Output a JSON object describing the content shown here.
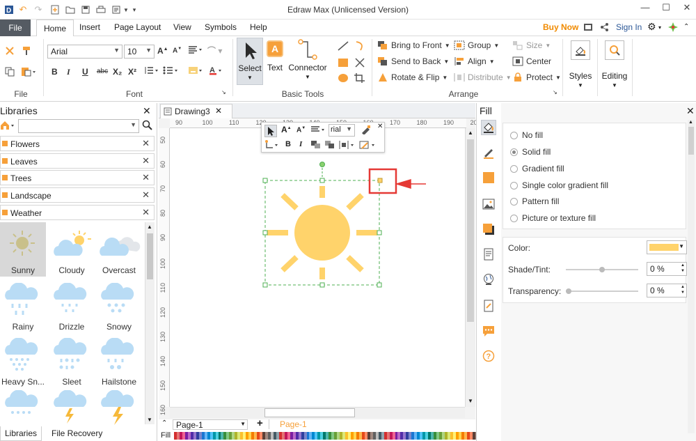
{
  "app": {
    "title": "Edraw Max (Unlicensed Version)",
    "buy_now": "Buy Now",
    "sign_in": "Sign In"
  },
  "menu": {
    "file": "File",
    "tabs": [
      "Home",
      "Insert",
      "Page Layout",
      "View",
      "Symbols",
      "Help"
    ]
  },
  "ribbon": {
    "font_name": "Arial",
    "font_size": "10",
    "groups": {
      "file": "File",
      "font": "Font",
      "basic_tools": "Basic Tools",
      "arrange": "Arrange"
    },
    "select": "Select",
    "text": "Text",
    "connector": "Connector",
    "bring_to_front": "Bring to Front",
    "send_to_back": "Send to Back",
    "rotate_flip": "Rotate & Flip",
    "group": "Group",
    "align": "Align",
    "distribute": "Distribute",
    "size": "Size",
    "center": "Center",
    "protect": "Protect",
    "styles": "Styles",
    "editing": "Editing",
    "text_icon_letter": "A",
    "format_marks": [
      "B",
      "I",
      "U",
      "abc",
      "X₂",
      "X²"
    ]
  },
  "libraries": {
    "title": "Libraries",
    "search_placeholder": "",
    "categories": [
      "Flowers",
      "Leaves",
      "Trees",
      "Landscape",
      "Weather"
    ],
    "tiles": [
      [
        "Sunny",
        "Cloudy",
        "Overcast"
      ],
      [
        "Rainy",
        "Drizzle",
        "Snowy"
      ],
      [
        "Heavy Sn...",
        "Sleet",
        "Hailstone"
      ]
    ],
    "bottom_tabs": [
      "Libraries",
      "File Recovery"
    ]
  },
  "document": {
    "tab_name": "Drawing3",
    "ruler_h": [
      "90",
      "100",
      "110",
      "120",
      "130",
      "140",
      "150",
      "160",
      "170",
      "180",
      "190",
      "200"
    ],
    "ruler_v": [
      "50",
      "60",
      "70",
      "80",
      "90",
      "100",
      "110",
      "120",
      "130",
      "140",
      "150",
      "160"
    ],
    "float_font": "rial",
    "page_select": "Page-1",
    "active_page": "Page-1",
    "fill_label": "Fill"
  },
  "fill_panel": {
    "title": "Fill",
    "options": [
      "No fill",
      "Solid fill",
      "Gradient fill",
      "Single color gradient fill",
      "Pattern fill",
      "Picture or texture fill"
    ],
    "selected_option": "Solid fill",
    "color_label": "Color:",
    "color_value": "#ffd36b",
    "shade_label": "Shade/Tint:",
    "shade_value": "0 %",
    "transparency_label": "Transparency:",
    "transparency_value": "0 %"
  },
  "colors": {
    "accent_orange": "#f6a03a",
    "sun": "#ffd36b",
    "highlight_red": "#e53935",
    "buy_now": "#f08a00",
    "sign_in": "#2b5797"
  }
}
